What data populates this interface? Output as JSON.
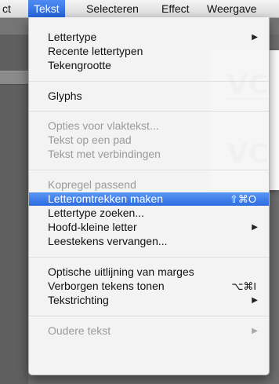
{
  "menubar": {
    "items": [
      {
        "label": "ct"
      },
      {
        "label": "Tekst"
      },
      {
        "label": "Selecteren"
      },
      {
        "label": "Effect"
      },
      {
        "label": "Weergave"
      }
    ]
  },
  "canvas": {
    "text_top": "VC",
    "text_bottom": "VC"
  },
  "menu": {
    "items": [
      {
        "label": "Lettertype",
        "submenu": true
      },
      {
        "label": "Recente lettertypen"
      },
      {
        "label": "Tekengrootte"
      },
      {
        "label": "Glyphs"
      },
      {
        "label": "Opties voor vlaktekst..."
      },
      {
        "label": "Tekst op een pad"
      },
      {
        "label": "Tekst met verbindingen"
      },
      {
        "label": "Kopregel passend"
      },
      {
        "label": "Letteromtrekken maken",
        "shortcut": "⇧⌘O"
      },
      {
        "label": "Lettertype zoeken..."
      },
      {
        "label": "Hoofd-kleine letter",
        "submenu": true
      },
      {
        "label": "Leestekens vervangen..."
      },
      {
        "label": "Optische uitlijning van marges"
      },
      {
        "label": "Verborgen tekens tonen",
        "shortcut": "⌥⌘I"
      },
      {
        "label": "Tekstrichting",
        "submenu": true
      },
      {
        "label": "Oudere tekst",
        "submenu": true
      }
    ]
  },
  "colors": {
    "highlight": "#2b6be0",
    "disabled_text": "#9a9a9a"
  },
  "icons": {
    "submenu": "triangle-right-icon"
  }
}
